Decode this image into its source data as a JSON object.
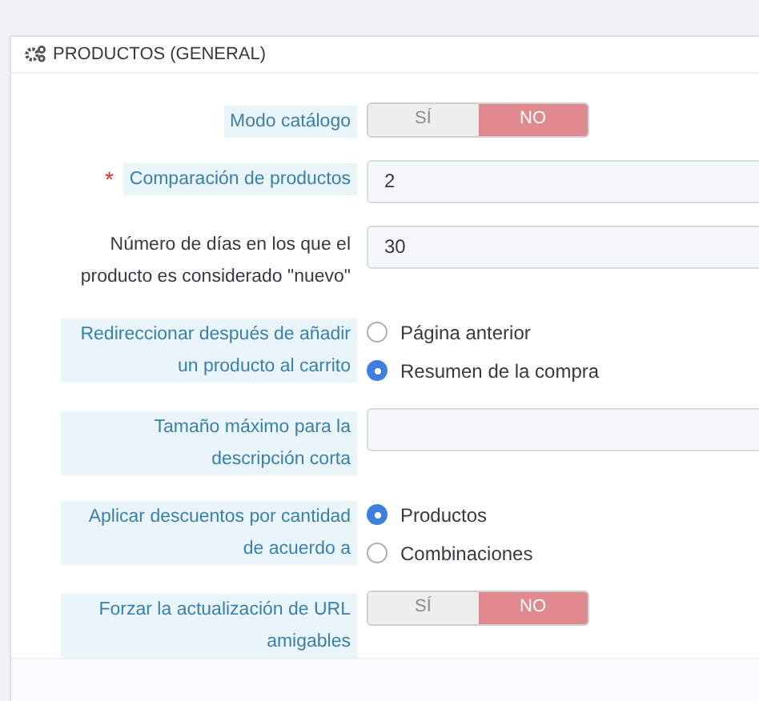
{
  "panel": {
    "title": "PRODUCTOS (GENERAL)"
  },
  "fields": [
    {
      "kind": "toggle",
      "label": "Modo catálogo",
      "help": true,
      "options": [
        {
          "label": "SÍ",
          "selected": false
        },
        {
          "label": "NO",
          "selected": true
        }
      ]
    },
    {
      "kind": "text",
      "label": "Comparación de productos",
      "help": true,
      "marker": "*",
      "value": "2"
    },
    {
      "kind": "text",
      "label": "Número de días en los que el producto es considerado \"nuevo\"",
      "help": false,
      "value": "30"
    },
    {
      "kind": "radio",
      "label": "Redireccionar después de añadir un producto al carrito",
      "help": true,
      "options": [
        {
          "label": "Página anterior",
          "selected": false
        },
        {
          "label": "Resumen de la compra",
          "selected": true
        }
      ]
    },
    {
      "kind": "text",
      "label": "Tamaño máximo para la descripción corta",
      "help": true
    },
    {
      "kind": "radio",
      "label": "Aplicar descuentos por cantidad de acuerdo a",
      "help": true,
      "options": [
        {
          "label": "Productos",
          "selected": true
        },
        {
          "label": "Combinaciones",
          "selected": false
        }
      ]
    },
    {
      "kind": "toggle",
      "label": "Forzar la actualización de URL amigables",
      "help": true,
      "options": [
        {
          "label": "SÍ",
          "selected": false
        },
        {
          "label": "NO",
          "selected": true
        }
      ]
    }
  ]
}
